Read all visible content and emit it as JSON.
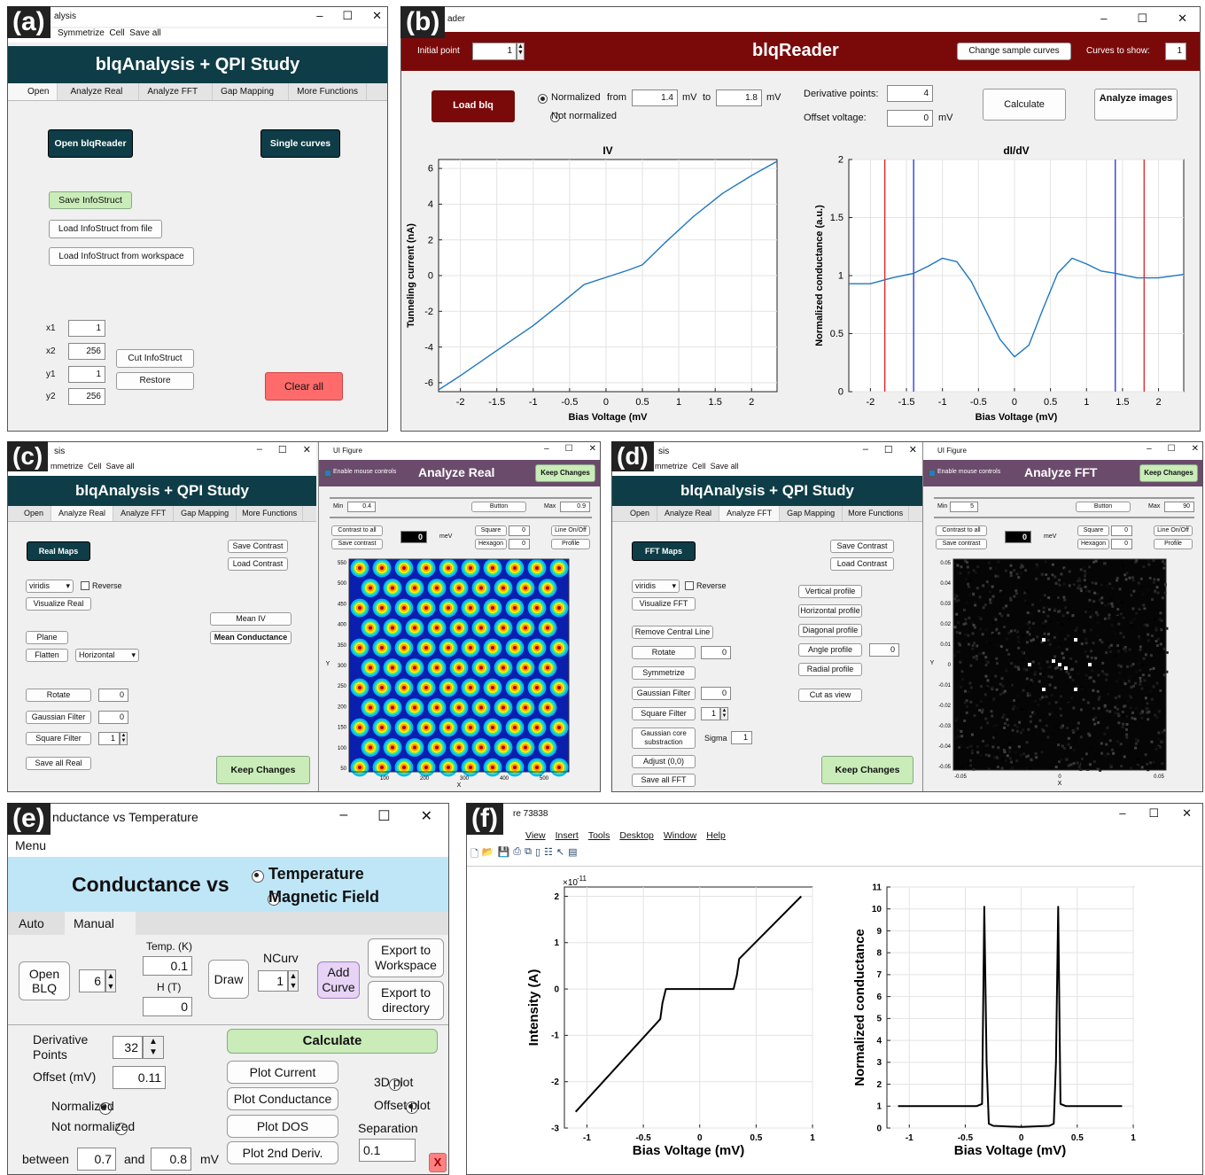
{
  "a": {
    "label": "(a)",
    "title": "alysis",
    "menu": [
      "Symmetrize",
      "Cell",
      "Save all"
    ],
    "banner": "blqAnalysis + QPI Study",
    "tabs": [
      "Open",
      "Analyze Real",
      "Analyze FFT",
      "Gap Mapping",
      "More Functions"
    ],
    "open_blqreader": "Open blqReader",
    "single_curves": "Single curves",
    "save_infostruct": "Save InfoStruct",
    "load_file": "Load InfoStruct from file",
    "load_workspace": "Load InfoStruct from workspace",
    "x1_label": "x1",
    "x1": "1",
    "x2_label": "x2",
    "x2": "256",
    "y1_label": "y1",
    "y1": "1",
    "y2_label": "y2",
    "y2": "256",
    "cut": "Cut InfoStruct",
    "restore": "Restore",
    "clear_all": "Clear all"
  },
  "b": {
    "label": "(b)",
    "title": "ader",
    "initial_point_label": "Initial point",
    "initial_point": "1",
    "app_title": "blqReader",
    "change_sample": "Change sample curves",
    "curves_to_show_label": "Curves to show:",
    "curves_to_show": "1",
    "load_blq": "Load blq",
    "normalized": "Normalized",
    "from": "from",
    "from_val": "1.4",
    "mv1": "mV",
    "to": "to",
    "to_val": "1.8",
    "mv2": "mV",
    "not_normalized": "Not normalized",
    "deriv_label": "Derivative points:",
    "deriv": "4",
    "offset_label": "Offset voltage:",
    "offset": "0",
    "mv3": "mV",
    "calculate": "Calculate",
    "analyze_images": "Analyze images",
    "iv_title": "IV",
    "iv_xlabel": "Bias Voltage (mV",
    "iv_ylabel": "Tunneling current (nA)",
    "didv_title": "dI/dV",
    "didv_xlabel": "Bias Voltage (mV)",
    "didv_ylabel": "Normalized conductance (a.u.)"
  },
  "c": {
    "label": "(c)",
    "title": "sis",
    "menu": [
      "mmetrize",
      "Cell",
      "Save all"
    ],
    "banner": "blqAnalysis + QPI Study",
    "tabs": [
      "Open",
      "Analyze Real",
      "Analyze FFT",
      "Gap Mapping",
      "More Functions"
    ],
    "real_maps": "Real Maps",
    "save_contrast": "Save Contrast",
    "load_contrast": "Load Contrast",
    "colormap": "viridis",
    "reverse": "Reverse",
    "visualize": "Visualize Real",
    "mean_iv": "Mean IV",
    "mean_cond": "Mean Conductance",
    "plane": "Plane",
    "flatten": "Flatten",
    "direction": "Horizontal",
    "rotate": "Rotate",
    "rotate_val": "0",
    "gauss": "Gaussian Filter",
    "gauss_val": "0",
    "square": "Square Filter",
    "square_val": "1",
    "save_all": "Save all Real",
    "keep": "Keep Changes",
    "fig_title": "UI Figure",
    "enable_mouse": "Enable mouse controls",
    "fig_head": "Analyze Real",
    "fig_keep": "Keep Changes",
    "min_label": "Min",
    "min": "0.4",
    "button": "Button",
    "max_label": "Max",
    "max": "0.9",
    "contrast_all": "Contrast to all",
    "save_contrast2": "Save contrast",
    "center_val": "0",
    "mev": "meV",
    "sq": "Square",
    "sq_val": "0",
    "hex": "Hexagon",
    "hex_val": "0",
    "line_onoff": "Line On/Off",
    "profile": "Profile",
    "yticks": [
      "550",
      "500",
      "450",
      "400",
      "350",
      "300",
      "250",
      "200",
      "150",
      "100",
      "50"
    ],
    "xticks": [
      "100",
      "200",
      "300",
      "400",
      "500"
    ],
    "xlabel": "X",
    "ylabel": "Y"
  },
  "d": {
    "label": "(d)",
    "title": "sis",
    "menu": [
      "mmetrize",
      "Cell",
      "Save all"
    ],
    "banner": "blqAnalysis + QPI Study",
    "tabs": [
      "Open",
      "Analyze Real",
      "Analyze FFT",
      "Gap Mapping",
      "More Functions"
    ],
    "fft_maps": "FFT Maps",
    "save_contrast": "Save Contrast",
    "load_contrast": "Load Contrast",
    "colormap": "viridis",
    "reverse": "Reverse",
    "visualize": "Visualize FFT",
    "remove_line": "Remove Central Line",
    "rotate": "Rotate",
    "rotate_val": "0",
    "symmetrize": "Symmetrize",
    "gauss": "Gaussian Filter",
    "gauss_val": "0",
    "square": "Square Filter",
    "square_val": "1",
    "gauss_core": "Gaussian core substraction",
    "sigma": "Sigma",
    "sigma_val": "1",
    "adjust": "Adjust (0,0)",
    "save_all": "Save all FFT",
    "vprof": "Vertical profile",
    "hprof": "Horizontal profile",
    "dprof": "Diagonal profile",
    "aprof": "Angle profile",
    "aprof_val": "0",
    "rprof": "Radial profile",
    "cut_view": "Cut as view",
    "keep": "Keep Changes",
    "fig_title": "UI Figure",
    "enable_mouse": "Enable mouse controls",
    "fig_head": "Analyze FFT",
    "fig_keep": "Keep Changes",
    "min_label": "Min",
    "min": "5",
    "button": "Button",
    "max_label": "Max",
    "max": "90",
    "contrast_all": "Contrast to all",
    "save_contrast2": "Save contrast",
    "center_val": "0",
    "mev": "meV",
    "sq": "Square",
    "sq_val": "0",
    "hex": "Hexagon",
    "hex_val": "0",
    "line_onoff": "Line On/Off",
    "profile": "Profile",
    "yticks": [
      "0.05",
      "0.04",
      "0.03",
      "0.02",
      "0.01",
      "0",
      "-0.01",
      "-0.02",
      "-0.03",
      "-0.04",
      "-0.05"
    ],
    "xticks": [
      "-0.05",
      "0",
      "0.05"
    ],
    "xlabel": "X",
    "ylabel": "Y"
  },
  "e": {
    "label": "(e)",
    "title": "nductance vs Temperature",
    "menu": "Menu",
    "head": "Conductance vs",
    "opt_temp": "Temperature",
    "opt_field": "Magnetic Field",
    "tabs": [
      "Auto",
      "Manual"
    ],
    "open_blq": "Open BLQ",
    "ncurv_val": "6",
    "temp_label": "Temp. (K)",
    "temp": "0.1",
    "h_label": "H (T)",
    "h": "0",
    "draw": "Draw",
    "ncurv_label": "NCurv",
    "ncurv": "1",
    "add_curve": "Add Curve",
    "export_ws": "Export to Workspace",
    "export_dir": "Export to directory",
    "deriv_label": "Derivative Points",
    "deriv": "32",
    "calculate": "Calculate",
    "offset_label": "Offset (mV)",
    "offset": "0.11",
    "plot_current": "Plot Current",
    "plot_cond": "Plot Conductance",
    "plot_dos": "Plot DOS",
    "plot_2nd": "Plot 2nd Deriv.",
    "plot3d": "3D plot",
    "offset_plot": "Offset plot",
    "separation": "Separation",
    "sep": "0.1",
    "normalized": "Normalized",
    "not_normalized": "Not normalized",
    "between": "between",
    "b1": "0.7",
    "and": "and",
    "b2": "0.8",
    "mv": "mV",
    "close": "X"
  },
  "f": {
    "label": "(f)",
    "title": "re 73838",
    "menu": [
      "View",
      "Insert",
      "Tools",
      "Desktop",
      "Window",
      "Help"
    ],
    "left_ylabel": "Intensity (A)",
    "left_xlabel": "Bias Voltage (mV)",
    "exp": "×10",
    "exp_pow": "-11",
    "right_ylabel": "Normalized conductance",
    "right_xlabel": "Bias Voltage (mV)"
  },
  "chart_data": [
    {
      "type": "line",
      "panel": "b",
      "title": "IV",
      "xlabel": "Bias Voltage (mV",
      "ylabel": "Tunneling current (nA)",
      "xlim": [
        -2.3,
        2.35
      ],
      "ylim": [
        -6.5,
        6.5
      ],
      "xticks": [
        -2,
        -1.5,
        -1,
        -0.5,
        0,
        0.5,
        1,
        1.5,
        2
      ],
      "yticks": [
        -6,
        -4,
        -2,
        0,
        2,
        4,
        6
      ],
      "x": [
        -2.3,
        -2,
        -1.5,
        -1,
        -0.6,
        -0.3,
        0,
        0.3,
        0.5,
        0.8,
        1.2,
        1.6,
        2,
        2.35
      ],
      "y": [
        -6.4,
        -5.6,
        -4.2,
        -2.8,
        -1.5,
        -0.5,
        -0.1,
        0.3,
        0.6,
        1.8,
        3.3,
        4.6,
        5.6,
        6.4
      ]
    },
    {
      "type": "line",
      "panel": "b",
      "title": "dI/dV",
      "xlabel": "Bias Voltage (mV)",
      "ylabel": "Normalized conductance (a.u.)",
      "xlim": [
        -2.3,
        2.35
      ],
      "ylim": [
        0,
        2
      ],
      "xticks": [
        -2,
        -1.5,
        -1,
        -0.5,
        0,
        0.5,
        1,
        1.5,
        2
      ],
      "yticks": [
        0,
        0.5,
        1,
        1.5,
        2
      ],
      "x": [
        -2.3,
        -2,
        -1.7,
        -1.4,
        -1.2,
        -1,
        -0.8,
        -0.6,
        -0.4,
        -0.2,
        0,
        0.2,
        0.4,
        0.6,
        0.8,
        1,
        1.2,
        1.4,
        1.7,
        2,
        2.35
      ],
      "y": [
        0.93,
        0.93,
        0.98,
        1.02,
        1.08,
        1.15,
        1.12,
        0.95,
        0.7,
        0.45,
        0.3,
        0.4,
        0.72,
        1.02,
        1.15,
        1.1,
        1.04,
        1.02,
        0.98,
        0.98,
        1.01
      ],
      "vlines_red": [
        -1.8,
        1.8
      ],
      "vlines_blue": [
        -1.4,
        1.4
      ]
    },
    {
      "type": "line",
      "panel": "f-left",
      "xlabel": "Bias Voltage (mV)",
      "ylabel": "Intensity (A)",
      "xlim": [
        -1.2,
        1
      ],
      "ylim": [
        -3,
        2.2
      ],
      "xticks": [
        -1,
        -0.5,
        0,
        0.5,
        1
      ],
      "yticks": [
        -3,
        -2,
        -1,
        0,
        1,
        2
      ],
      "x": [
        -1.1,
        -0.35,
        -0.33,
        -0.3,
        0.3,
        0.33,
        0.35,
        0.9
      ],
      "y": [
        -2.65,
        -0.65,
        -0.3,
        0,
        0,
        0.3,
        0.65,
        2
      ]
    },
    {
      "type": "line",
      "panel": "f-right",
      "xlabel": "Bias Voltage (mV)",
      "ylabel": "Normalized conductance",
      "xlim": [
        -1.2,
        1
      ],
      "ylim": [
        0,
        11
      ],
      "xticks": [
        -1,
        -0.5,
        0,
        0.5,
        1
      ],
      "yticks": [
        0,
        1,
        2,
        3,
        4,
        5,
        6,
        7,
        8,
        9,
        10,
        11
      ],
      "x": [
        -1.1,
        -0.4,
        -0.35,
        -0.33,
        -0.31,
        -0.29,
        -0.25,
        0,
        0.25,
        0.29,
        0.31,
        0.33,
        0.35,
        0.4,
        0.9
      ],
      "y": [
        1,
        1,
        1.1,
        10.1,
        3,
        0.2,
        0.1,
        0.05,
        0.1,
        0.2,
        3,
        10.1,
        1.1,
        1,
        1
      ]
    }
  ]
}
